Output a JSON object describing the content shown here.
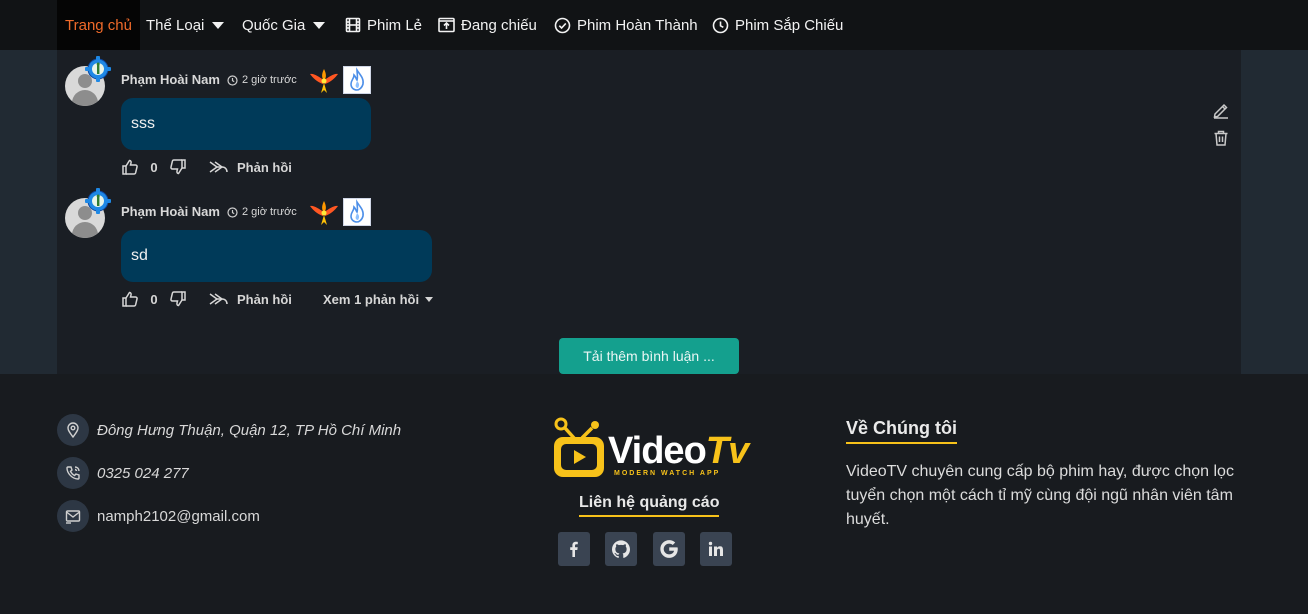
{
  "nav": {
    "home": "Trang chủ",
    "genre": "Thể Loại",
    "country": "Quốc Gia",
    "single": "Phim Lẻ",
    "showing": "Đang chiếu",
    "completed": "Phim Hoàn Thành",
    "upcoming": "Phim Sắp Chiếu"
  },
  "comments": [
    {
      "author": "Phạm Hoài Nam",
      "time": "2 giờ trước",
      "text": "sss",
      "likes": "0",
      "reply_label": "Phản hồi"
    },
    {
      "author": "Phạm Hoài Nam",
      "time": "2 giờ trước",
      "text": "sd",
      "likes": "0",
      "reply_label": "Phản hồi",
      "view_replies": "Xem 1 phản hồi"
    }
  ],
  "load_more": "Tải thêm bình luận ...",
  "footer": {
    "address": "Đông Hưng Thuận, Quận 12, TP Hồ Chí Minh",
    "phone": "0325 024 277",
    "email": "namph2102@gmail.com",
    "logo_main": "Video",
    "logo_accent": "Tv",
    "logo_tagline": "MODERN WATCH APP",
    "ad_contact": "Liên hệ quảng cáo",
    "about_title": "Về Chúng tôi",
    "about_text": "VideoTV chuyên cung cấp bộ phim hay, được chọn lọc tuyển chọn một cách tỉ mỹ cùng đội ngũ nhân viên tâm huyết."
  },
  "colors": {
    "accent": "#ef6a2a",
    "brand_yellow": "#f7c21a",
    "bubble": "#003a59",
    "button": "#14a08e"
  }
}
